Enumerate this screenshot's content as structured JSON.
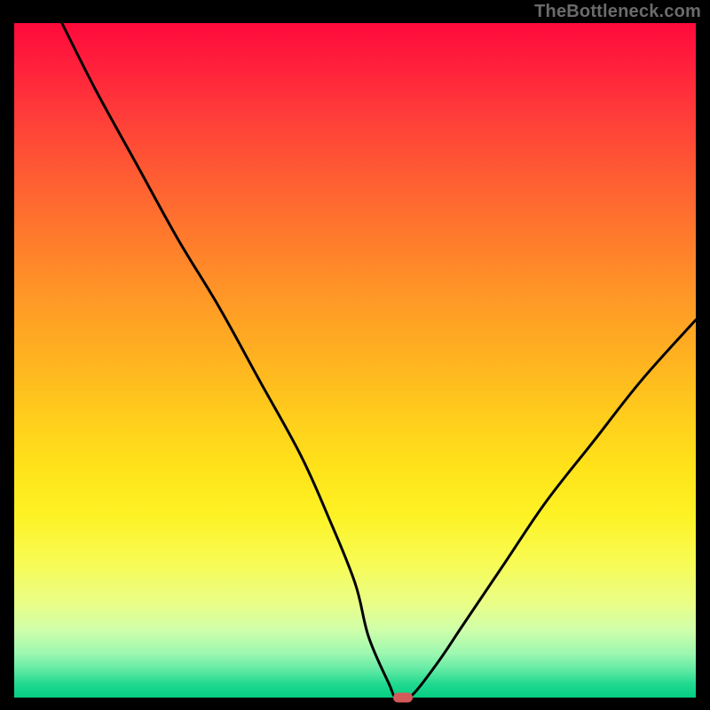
{
  "watermark": "TheBottleneck.com",
  "chart_data": {
    "type": "line",
    "title": "",
    "xlabel": "",
    "ylabel": "",
    "xlim": [
      0,
      100
    ],
    "ylim": [
      0,
      100
    ],
    "grid": false,
    "legend": false,
    "series": [
      {
        "name": "bottleneck-curve",
        "x": [
          7,
          12,
          18,
          24,
          30,
          36,
          42,
          46,
          50,
          52,
          55,
          56,
          58,
          62,
          66,
          72,
          78,
          85,
          92,
          100
        ],
        "values": [
          100,
          90,
          79,
          68,
          58,
          47,
          36,
          27,
          17,
          9,
          2,
          0,
          0,
          5,
          11,
          20,
          29,
          38,
          47,
          56
        ]
      }
    ],
    "marker": {
      "x": 57,
      "y": 0,
      "label": "optimal-point"
    },
    "background_gradient": {
      "direction": "vertical",
      "stops": [
        {
          "pos": 0.0,
          "hex": "#ff0a3b"
        },
        {
          "pos": 0.5,
          "hex": "#ffb320"
        },
        {
          "pos": 0.8,
          "hex": "#f7fb54"
        },
        {
          "pos": 1.0,
          "hex": "#04ce82"
        }
      ]
    },
    "colors": {
      "curve": "#000000",
      "frame": "#000000",
      "marker": "#d45a5a"
    }
  }
}
